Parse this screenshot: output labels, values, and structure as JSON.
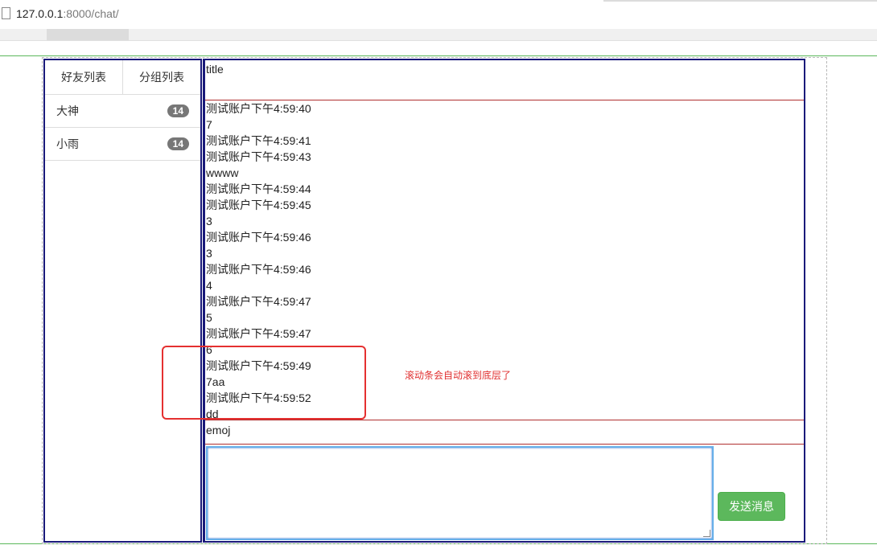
{
  "browser": {
    "url_host": "127.0.0.1",
    "url_path": ":8000/chat/"
  },
  "sidebar": {
    "tabs": [
      {
        "label": "好友列表"
      },
      {
        "label": "分组列表"
      }
    ],
    "friends": [
      {
        "name": "大神",
        "count": "14"
      },
      {
        "name": "小雨",
        "count": "14"
      }
    ]
  },
  "chat": {
    "title": "title",
    "messages": [
      "测试账户下午4:59:40",
      "7",
      "测试账户下午4:59:41",
      "测试账户下午4:59:43",
      "wwww",
      "测试账户下午4:59:44",
      "测试账户下午4:59:45",
      "3",
      "测试账户下午4:59:46",
      "3",
      "测试账户下午4:59:46",
      "4",
      "测试账户下午4:59:47",
      "5",
      "测试账户下午4:59:47",
      "6",
      "测试账户下午4:59:49",
      "7aa",
      "测试账户下午4:59:52",
      "dd"
    ],
    "emoj_label": "emoj",
    "send_label": "发送消息"
  },
  "annotation": {
    "text": "滚动条会自动滚到底层了",
    "color": "#e03030"
  },
  "colors": {
    "panel_border": "#1a1a7a",
    "divider": "#b03030",
    "send_button": "#5cb85c",
    "badge": "#777777"
  }
}
